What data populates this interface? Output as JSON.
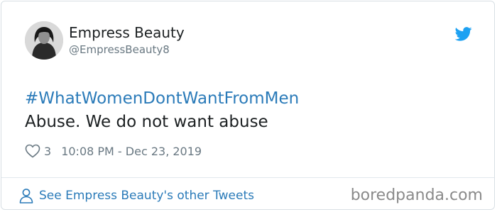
{
  "tweet": {
    "author": {
      "display_name": "Empress Beauty",
      "handle": "@EmpressBeauty8"
    },
    "hashtag": "#WhatWomenDontWantFromMen",
    "text": "Abuse. We do not want abuse",
    "likes": "3",
    "timestamp": "10:08 PM - Dec 23, 2019"
  },
  "footer": {
    "other_tweets_label": "See Empress Beauty's other Tweets"
  },
  "watermark": "boredpanda.com",
  "icons": {
    "brand": "twitter-bird-icon",
    "like": "heart-icon",
    "profile": "person-icon"
  },
  "colors": {
    "link": "#2b7bb9",
    "twitter_blue": "#1da1f2",
    "text": "#1c2022",
    "muted": "#697882"
  }
}
